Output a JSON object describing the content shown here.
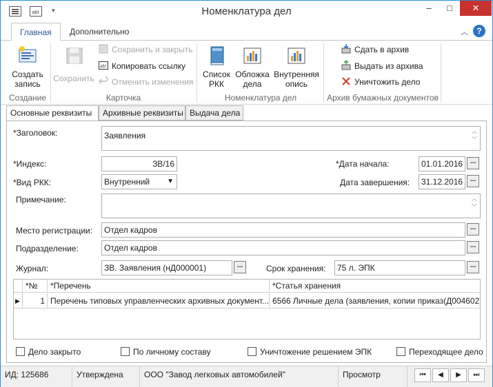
{
  "window": {
    "title": "Номенклатура дел",
    "controls": {
      "minimize": "–",
      "maximize": "□",
      "close": "✕"
    }
  },
  "ribbon_tabs": [
    "Главная",
    "Дополнительно"
  ],
  "ribbon": {
    "groups": {
      "create": {
        "label": "Создание",
        "create_record": "Создать запись"
      },
      "card": {
        "label": "Карточка",
        "save": "Сохранить",
        "save_close": "Сохранить и закрыть",
        "copy_link": "Копировать ссылку",
        "undo_changes": "Отменить изменения"
      },
      "nomenclature": {
        "label": "Номенклатура дел",
        "list_rkk": "Список РКК",
        "cover": "Обложка дела",
        "inner_inventory": "Внутренняя опись"
      },
      "archive": {
        "label": "Архив бумажных документов",
        "to_archive": "Сдать в архив",
        "from_archive": "Выдать из архива",
        "destroy": "Уничтожить дело"
      }
    }
  },
  "form_tabs": [
    "Основные реквизиты",
    "Архивные реквизиты",
    "Выдача дела"
  ],
  "form": {
    "title_label": "*Заголовок:",
    "title_value": "Заявления",
    "index_label": "*Индекс:",
    "index_value": "ЗВ/16",
    "start_label": "*Дата начала:",
    "start_value": "01.01.2016",
    "rkk_label": "*Вид РКК:",
    "rkk_value": "Внутренний",
    "end_label": "Дата завершения:",
    "end_value": "31.12.2016",
    "note_label": "Примечание:",
    "note_value": "",
    "reg_label": "Место регистрации:",
    "reg_value": "Отдел кадров",
    "dept_label": "Подразделение:",
    "dept_value": "Отдел кадров",
    "journal_label": "Журнал:",
    "journal_value": "ЗВ. Заявления (нД000001)",
    "storage_label": "Срок хранения:",
    "storage_value": "75 л. ЭПК"
  },
  "grid": {
    "headers": [
      "*№",
      "*Перечень",
      "*Статья хранения"
    ],
    "rows": [
      {
        "num": "1",
        "list": "Перечень типовых управленческих архивных документ...",
        "article": "6566 Личные дела (заявления, копии приказ(Д004602)"
      }
    ]
  },
  "checkboxes": {
    "closed": "Дело закрыто",
    "personnel": "По личному составу",
    "destroy_epk": "Уничтожение решением ЭПК",
    "transitional": "Переходящее дело"
  },
  "status": {
    "id": "ИД: 125686",
    "state": "Утверждена",
    "org": "ООО \"Завод легковых автомобилей\"",
    "mode": "Просмотр"
  }
}
